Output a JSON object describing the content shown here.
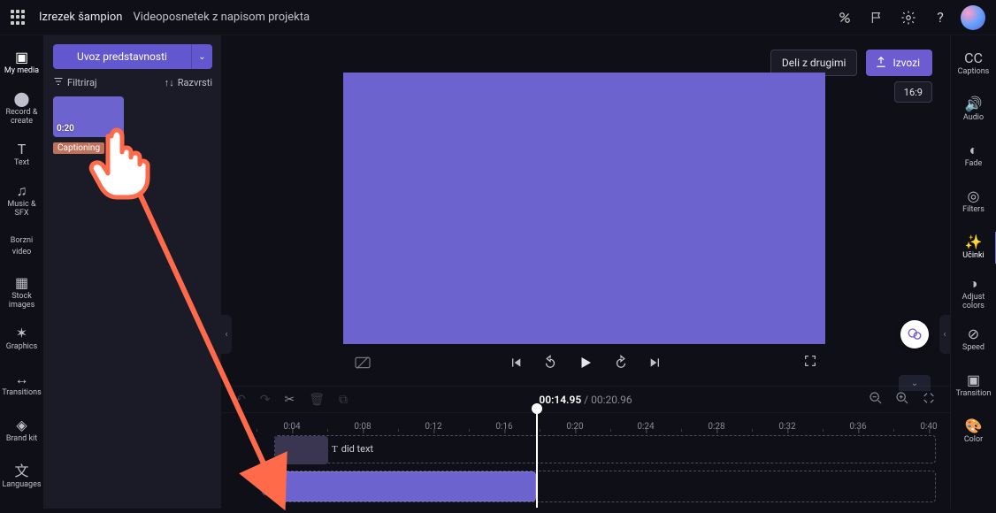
{
  "topbar": {
    "app_label": "Izrezek šampion",
    "project_title": "Videoposnetek z napisom projekta"
  },
  "leftnav": {
    "items": [
      {
        "icon": "▣",
        "label": "My media",
        "active": true
      },
      {
        "icon": "⬤",
        "label": "Record & create"
      },
      {
        "icon": "T",
        "label": "Text"
      },
      {
        "icon": "♫",
        "label": "Music & SFX"
      },
      {
        "icon": "Borzni",
        "label": "video",
        "textIcon": true
      },
      {
        "icon": "▦",
        "label": "Stock images"
      },
      {
        "icon": "✶",
        "label": "Graphics"
      },
      {
        "icon": "↔",
        "label": "Transitions"
      },
      {
        "icon": "◈",
        "label": "Brand kit"
      },
      {
        "icon": "文",
        "label": "Languages"
      }
    ]
  },
  "rightnav": {
    "items": [
      {
        "icon": "CC",
        "label": "Captions"
      },
      {
        "icon": "🔊",
        "label": "Audio"
      },
      {
        "icon": "◐",
        "label": "Fade"
      },
      {
        "icon": "◎",
        "label": "Filters"
      },
      {
        "icon": "✨",
        "label": "Učinki",
        "active": true
      },
      {
        "icon": "◑",
        "label": "Adjust colors"
      },
      {
        "icon": "⊘",
        "label": "Speed"
      },
      {
        "icon": "▣",
        "label": "Transition"
      },
      {
        "icon": "🎨",
        "label": "Color"
      }
    ]
  },
  "mediapanel": {
    "import_label": "Uvoz predstavnosti",
    "filter_label": "Filtriraj",
    "sort_label": "Razvrsti",
    "thumb_duration": "0:20",
    "thumb_caption": "Captioning"
  },
  "header_actions": {
    "share_label": "Deli z drugimi",
    "export_label": "Izvozi",
    "aspect_label": "16:9"
  },
  "timeline": {
    "current_time": "00:14.95",
    "total_time": "00:20.96",
    "text_clip_label": "did text",
    "ticks": [
      "0:04",
      "0:08",
      "0:12",
      "0:16",
      "0:20",
      "0:24",
      "0:28",
      "0:32",
      "0:36",
      "0:40"
    ]
  }
}
